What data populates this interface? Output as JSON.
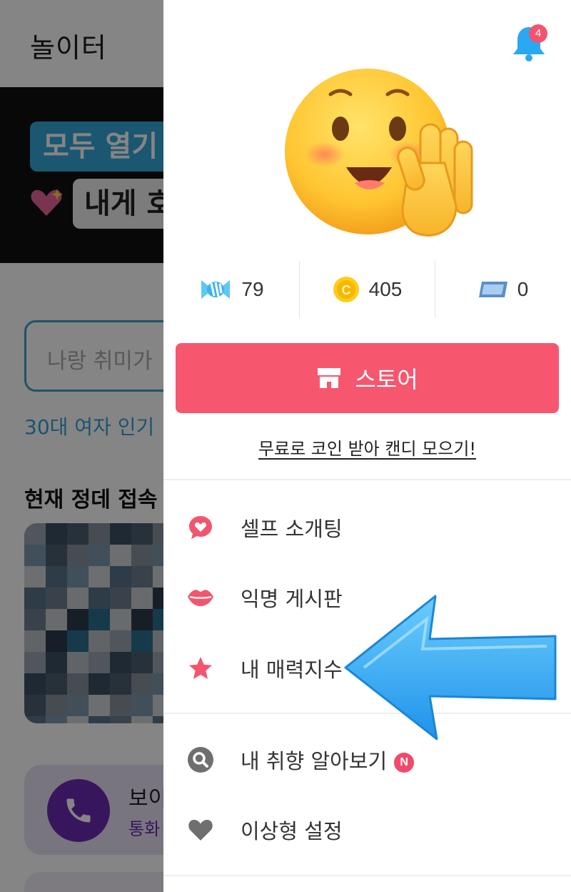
{
  "background": {
    "title": "놀이터",
    "banner_chip_1": "모두 열기",
    "banner_chip_2": "내게 호",
    "search_placeholder": "나랑 취미가",
    "tag": "30대 여자 인기",
    "section_title": "현재 정데 접속",
    "call_card_title": "보이",
    "call_card_subtitle": "통화"
  },
  "drawer": {
    "notification_count": "4",
    "stats": [
      {
        "icon": "candy-icon",
        "value": "79"
      },
      {
        "icon": "coin-icon",
        "value": "405"
      },
      {
        "icon": "ticket-icon",
        "value": "0"
      }
    ],
    "store_button_label": "스토어",
    "free_coin_link": "무료로 코인 받아 캔디 모으기!",
    "menu_group_1": [
      {
        "icon": "chat-heart-icon",
        "label": "셀프 소개팅"
      },
      {
        "icon": "lips-icon",
        "label": "익명 게시판"
      },
      {
        "icon": "star-icon",
        "label": "내 매력지수"
      }
    ],
    "menu_group_2": [
      {
        "icon": "search-icon",
        "label": "내 취향 알아보기",
        "badge": "N"
      },
      {
        "icon": "heart-icon",
        "label": "이상형 설정"
      }
    ]
  },
  "colors": {
    "accent": "#f7566f",
    "menu_icon": "#f2566f",
    "pointer_arrow": "#3db0f7",
    "dim_overlay": "rgba(0,0,0,0.48)"
  }
}
